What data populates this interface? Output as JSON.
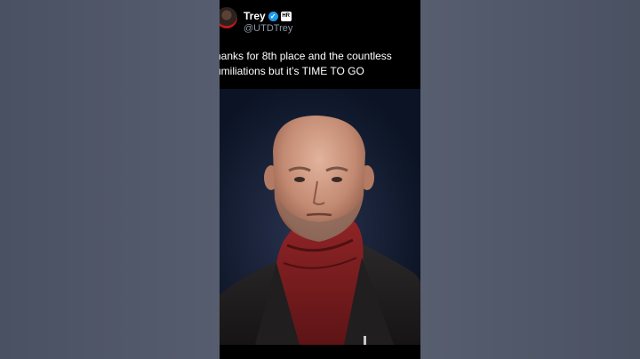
{
  "tweet": {
    "author_name": "Trey",
    "handle": "@UTDTrey",
    "badge_text": "HR",
    "verified_icon": "check-icon",
    "text": "hanks for 8th place and the countless\numiliations but it’s TIME TO GO"
  },
  "colors": {
    "page_background": "#4d5465",
    "frame_background": "#000000",
    "verified_blue": "#1d9bf0",
    "handle_gray": "#8b98a5",
    "turtleneck_red": "#7a1c1e"
  }
}
